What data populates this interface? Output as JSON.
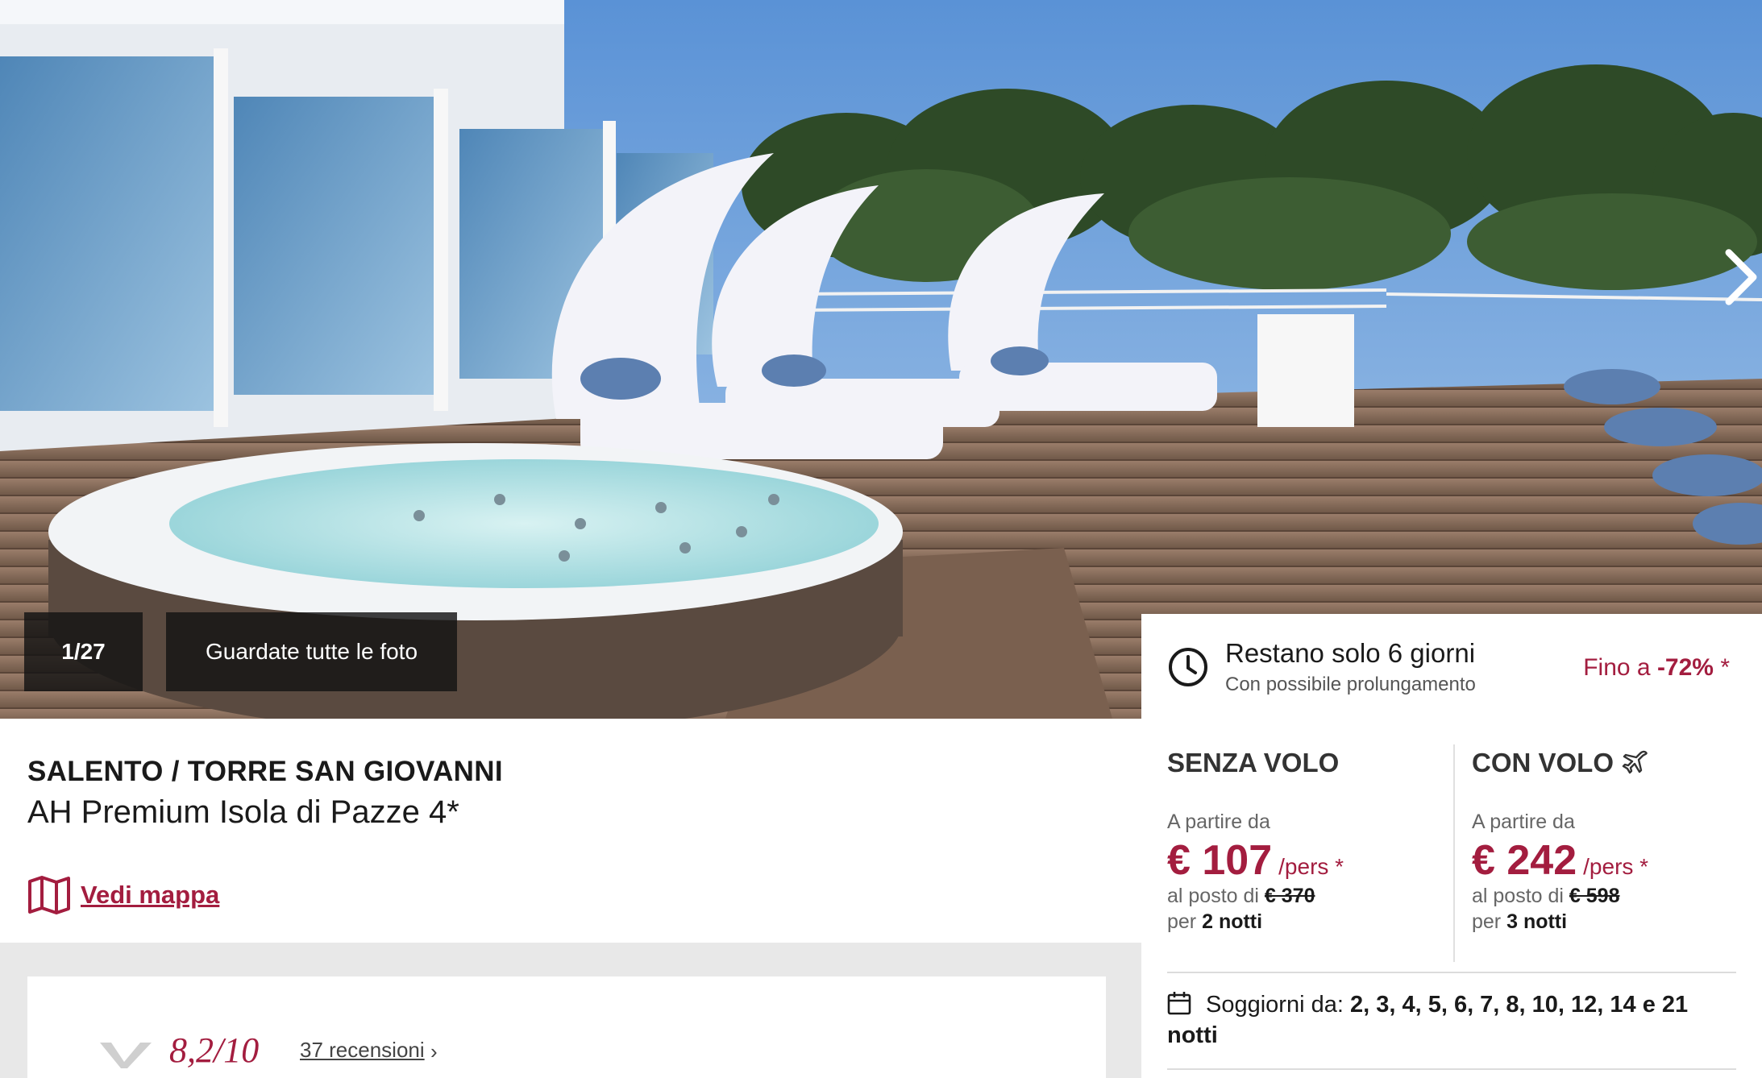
{
  "gallery": {
    "counter": "1/27",
    "view_all_label": "Guardate tutte le foto"
  },
  "countdown": {
    "title": "Restano solo 6 giorni",
    "subtitle": "Con possibile prolungamento",
    "discount_prefix": "Fino a ",
    "discount_value": "-72%",
    "discount_suffix": " *"
  },
  "listing": {
    "destination": "SALENTO / TORRE SAN GIOVANNI",
    "hotel_name": "AH Premium Isola di Pazze 4*",
    "map_link": "Vedi mappa"
  },
  "reviews": {
    "score": "8,2/10",
    "count_label": "37 recensioni",
    "chevron": "›"
  },
  "offers": {
    "without_flight": {
      "title": "SENZA VOLO",
      "from_label": "A partire da",
      "price": "€ 107",
      "unit": "/pers *",
      "instead_label": "al posto di ",
      "old_price": "€ 370",
      "per_label": "per ",
      "nights": "2 notti"
    },
    "with_flight": {
      "title": "CON VOLO",
      "from_label": "A partire da",
      "price": "€ 242",
      "unit": "/pers *",
      "instead_label": "al posto di ",
      "old_price": "€ 598",
      "per_label": "per ",
      "nights": "3 notti"
    },
    "stays_label": "Soggiorni da: ",
    "stays_values": "2, 3, 4, 5, 6, 7, 8, 10, 12, 14 e 21 notti"
  },
  "colors": {
    "accent": "#a31d3f",
    "overlay": "#141414",
    "band": "#e8e8e8"
  },
  "icons": [
    "chevron-right-icon",
    "clock-icon",
    "map-icon",
    "airplane-icon",
    "calendar-icon",
    "reviews-logo-icon"
  ]
}
